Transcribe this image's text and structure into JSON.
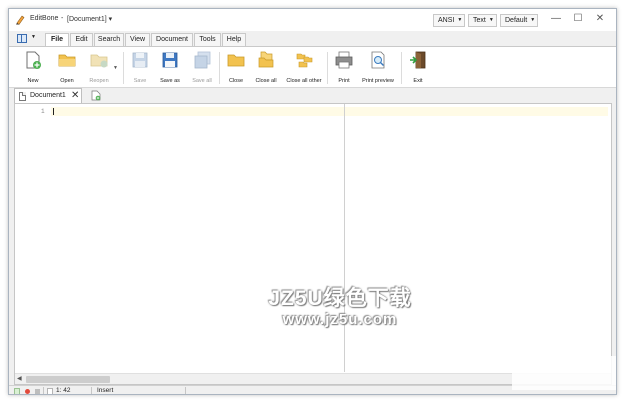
{
  "window": {
    "app_name": "EditBone",
    "separator": "-",
    "document_title": "[Document1] ▾",
    "encoding": "ANSI",
    "highlighter": "Text",
    "color_scheme": "Default",
    "minimize_glyph": "—",
    "maximize_glyph": "☐",
    "close_glyph": "✕"
  },
  "ribbon_tabs": [
    "File",
    "Edit",
    "Search",
    "View",
    "Document",
    "Tools",
    "Help"
  ],
  "active_tab": "File",
  "toolbar": {
    "new": "New",
    "open": "Open",
    "reopen": "Reopen",
    "save": "Save",
    "save_as": "Save as",
    "save_all": "Save all",
    "close": "Close",
    "close_all": "Close all",
    "close_all_other": "Close all other",
    "print": "Print",
    "print_preview": "Print preview",
    "exit": "Exit"
  },
  "document_tabs": [
    {
      "name": "Document1",
      "close_glyph": "✕"
    }
  ],
  "editor": {
    "line_numbers": [
      "1"
    ]
  },
  "watermark": {
    "line1": "JZ5U绿色下载",
    "line2": "www.jz5u.com"
  },
  "statusbar": {
    "position": "1: 42",
    "mode": "Insert"
  },
  "colors": {
    "accent": "#3a6cb0",
    "current_line": "#fffbe6",
    "folder": "#f2c24f"
  }
}
